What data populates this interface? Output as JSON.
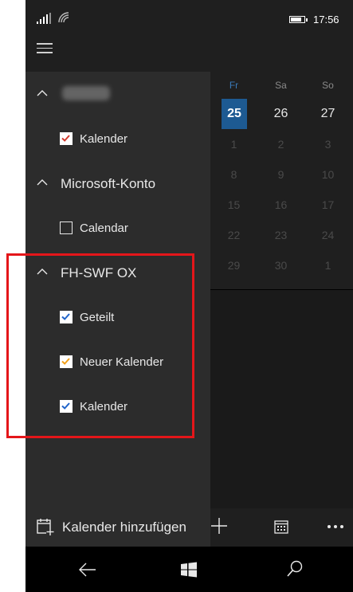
{
  "status_bar": {
    "time": "17:56",
    "battery_level": 0.9
  },
  "calendar": {
    "weekdays": [
      "Fr",
      "Sa",
      "So"
    ],
    "rows": [
      [
        "25",
        "26",
        "27"
      ],
      [
        "1",
        "2",
        "3"
      ],
      [
        "8",
        "9",
        "10"
      ],
      [
        "15",
        "16",
        "17"
      ],
      [
        "22",
        "23",
        "24"
      ],
      [
        "29",
        "30",
        "1"
      ]
    ],
    "today": "25"
  },
  "accounts": [
    {
      "name": "",
      "name_redacted": true,
      "expanded": true,
      "calendars": [
        {
          "label": "Kalender",
          "checked": true,
          "color": "#d23a2e"
        }
      ]
    },
    {
      "name": "Microsoft-Konto",
      "expanded": true,
      "calendars": [
        {
          "label": "Calendar",
          "checked": false,
          "color": ""
        }
      ]
    },
    {
      "name": "FH-SWF OX",
      "expanded": true,
      "calendars": [
        {
          "label": "Geteilt",
          "checked": true,
          "color": "#1f63c9"
        },
        {
          "label": "Neuer Kalender",
          "checked": true,
          "color": "#f2a019"
        },
        {
          "label": "Kalender",
          "checked": true,
          "color": "#1f63c9"
        }
      ]
    }
  ],
  "app_bar": {
    "add_calendar_label": "Kalender hinzufügen"
  },
  "colors": {
    "accent": "#1d5a92",
    "annotation": "#e4161a",
    "pane": "#2c2c2c",
    "background": "#1f1f1f"
  },
  "icons": [
    "signal-icon",
    "wifi-icon",
    "battery-icon",
    "hamburger-icon",
    "chevron-up-icon",
    "checkbox-icon",
    "add-calendar-icon",
    "plus-icon",
    "calendar-view-icon",
    "more-icon",
    "back-icon",
    "windows-icon",
    "search-icon"
  ]
}
